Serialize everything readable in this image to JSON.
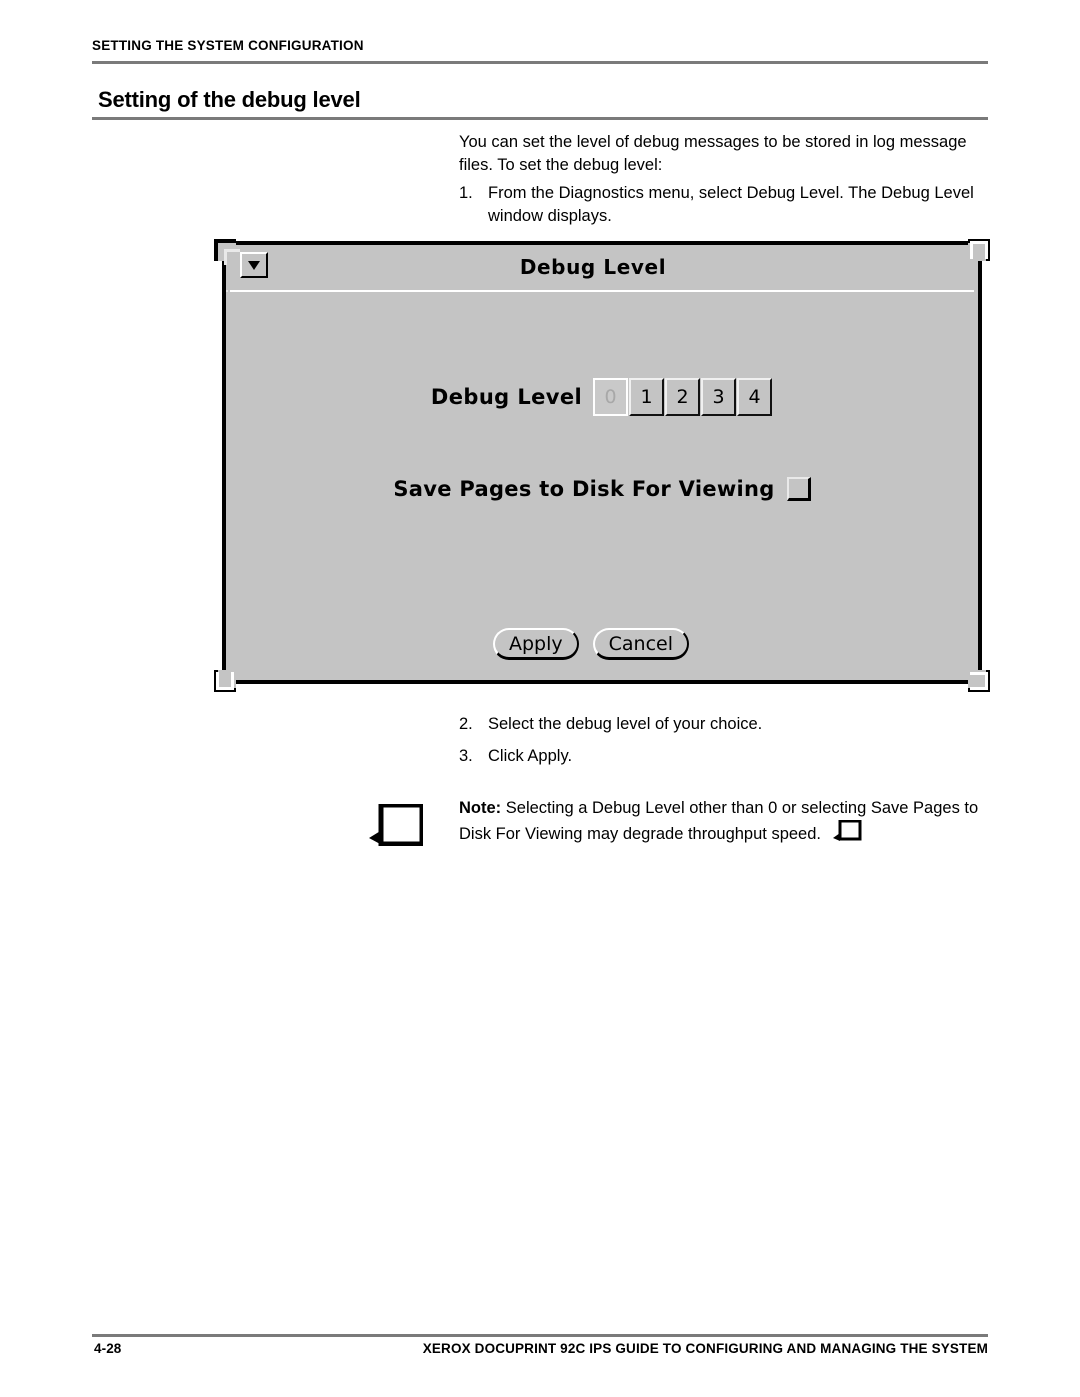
{
  "header": {
    "running_title": "SETTING THE SYSTEM CONFIGURATION",
    "section_heading": "Setting of the debug level"
  },
  "body": {
    "intro": "You can set the level of debug messages to be stored in log message files. To set the debug level:",
    "steps_before_figure": [
      {
        "num": "1.",
        "text": "From the Diagnostics menu, select Debug Level. The Debug Level window displays."
      }
    ],
    "steps_after_figure": [
      {
        "num": "2.",
        "text": "Select the debug level of your choice."
      },
      {
        "num": "3.",
        "text": "Click Apply."
      }
    ]
  },
  "note": {
    "label": "Note:",
    "text": "Selecting a Debug Level other than 0 or selecting Save Pages to Disk For Viewing may degrade throughput speed.",
    "icon": "note-flag-icon",
    "end_icon": "note-flag-end-icon"
  },
  "figure": {
    "window_title": "Debug Level",
    "menu_button_icon": "triangle-down-icon",
    "debug_level": {
      "label": "Debug Level",
      "options": [
        "0",
        "1",
        "2",
        "3",
        "4"
      ],
      "selected": "0"
    },
    "save_pages": {
      "label": "Save Pages to Disk For Viewing",
      "checked": false
    },
    "buttons": {
      "apply": "Apply",
      "cancel": "Cancel"
    },
    "colors": {
      "window_face": "#c4c4c4",
      "shadow": "#000000",
      "highlight": "#ffffff"
    }
  },
  "footer": {
    "page_number": "4-28",
    "guide_title": "XEROX DOCUPRINT 92C IPS GUIDE TO CONFIGURING AND MANAGING THE SYSTEM"
  }
}
